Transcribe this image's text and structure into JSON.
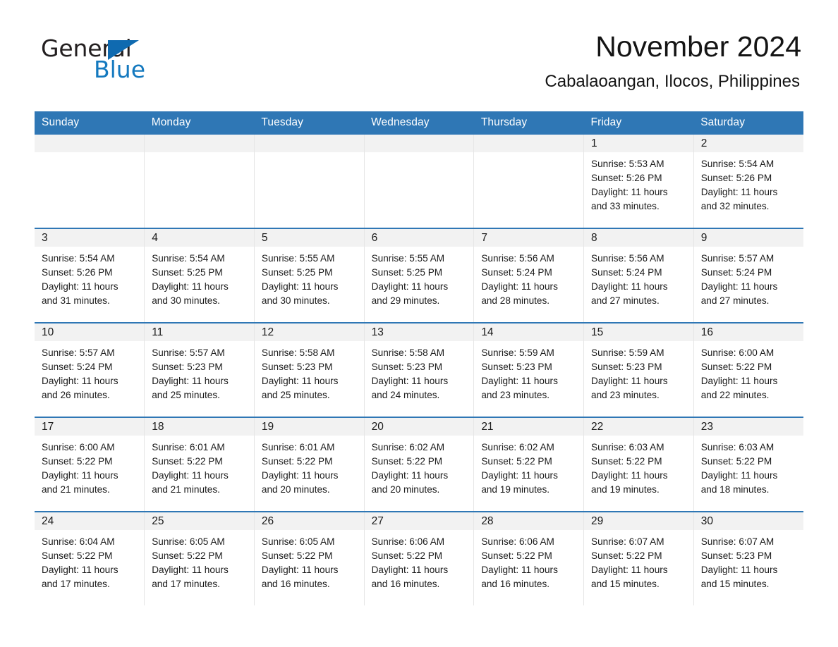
{
  "brand": {
    "name_part1": "General",
    "name_part2": "Blue",
    "triangle_color": "#0f6ab0",
    "blue_text_color": "#1479bf"
  },
  "header": {
    "title": "November 2024",
    "subtitle": "Cabalaoangan, Ilocos, Philippines",
    "header_bg_color": "#2f77b5",
    "daynum_band_color": "#f2f2f2"
  },
  "weekdays": [
    "Sunday",
    "Monday",
    "Tuesday",
    "Wednesday",
    "Thursday",
    "Friday",
    "Saturday"
  ],
  "weeks": [
    [
      {
        "day": "",
        "info": ""
      },
      {
        "day": "",
        "info": ""
      },
      {
        "day": "",
        "info": ""
      },
      {
        "day": "",
        "info": ""
      },
      {
        "day": "",
        "info": ""
      },
      {
        "day": "1",
        "info": "Sunrise: 5:53 AM\nSunset: 5:26 PM\nDaylight: 11 hours\nand 33 minutes."
      },
      {
        "day": "2",
        "info": "Sunrise: 5:54 AM\nSunset: 5:26 PM\nDaylight: 11 hours\nand 32 minutes."
      }
    ],
    [
      {
        "day": "3",
        "info": "Sunrise: 5:54 AM\nSunset: 5:26 PM\nDaylight: 11 hours\nand 31 minutes."
      },
      {
        "day": "4",
        "info": "Sunrise: 5:54 AM\nSunset: 5:25 PM\nDaylight: 11 hours\nand 30 minutes."
      },
      {
        "day": "5",
        "info": "Sunrise: 5:55 AM\nSunset: 5:25 PM\nDaylight: 11 hours\nand 30 minutes."
      },
      {
        "day": "6",
        "info": "Sunrise: 5:55 AM\nSunset: 5:25 PM\nDaylight: 11 hours\nand 29 minutes."
      },
      {
        "day": "7",
        "info": "Sunrise: 5:56 AM\nSunset: 5:24 PM\nDaylight: 11 hours\nand 28 minutes."
      },
      {
        "day": "8",
        "info": "Sunrise: 5:56 AM\nSunset: 5:24 PM\nDaylight: 11 hours\nand 27 minutes."
      },
      {
        "day": "9",
        "info": "Sunrise: 5:57 AM\nSunset: 5:24 PM\nDaylight: 11 hours\nand 27 minutes."
      }
    ],
    [
      {
        "day": "10",
        "info": "Sunrise: 5:57 AM\nSunset: 5:24 PM\nDaylight: 11 hours\nand 26 minutes."
      },
      {
        "day": "11",
        "info": "Sunrise: 5:57 AM\nSunset: 5:23 PM\nDaylight: 11 hours\nand 25 minutes."
      },
      {
        "day": "12",
        "info": "Sunrise: 5:58 AM\nSunset: 5:23 PM\nDaylight: 11 hours\nand 25 minutes."
      },
      {
        "day": "13",
        "info": "Sunrise: 5:58 AM\nSunset: 5:23 PM\nDaylight: 11 hours\nand 24 minutes."
      },
      {
        "day": "14",
        "info": "Sunrise: 5:59 AM\nSunset: 5:23 PM\nDaylight: 11 hours\nand 23 minutes."
      },
      {
        "day": "15",
        "info": "Sunrise: 5:59 AM\nSunset: 5:23 PM\nDaylight: 11 hours\nand 23 minutes."
      },
      {
        "day": "16",
        "info": "Sunrise: 6:00 AM\nSunset: 5:22 PM\nDaylight: 11 hours\nand 22 minutes."
      }
    ],
    [
      {
        "day": "17",
        "info": "Sunrise: 6:00 AM\nSunset: 5:22 PM\nDaylight: 11 hours\nand 21 minutes."
      },
      {
        "day": "18",
        "info": "Sunrise: 6:01 AM\nSunset: 5:22 PM\nDaylight: 11 hours\nand 21 minutes."
      },
      {
        "day": "19",
        "info": "Sunrise: 6:01 AM\nSunset: 5:22 PM\nDaylight: 11 hours\nand 20 minutes."
      },
      {
        "day": "20",
        "info": "Sunrise: 6:02 AM\nSunset: 5:22 PM\nDaylight: 11 hours\nand 20 minutes."
      },
      {
        "day": "21",
        "info": "Sunrise: 6:02 AM\nSunset: 5:22 PM\nDaylight: 11 hours\nand 19 minutes."
      },
      {
        "day": "22",
        "info": "Sunrise: 6:03 AM\nSunset: 5:22 PM\nDaylight: 11 hours\nand 19 minutes."
      },
      {
        "day": "23",
        "info": "Sunrise: 6:03 AM\nSunset: 5:22 PM\nDaylight: 11 hours\nand 18 minutes."
      }
    ],
    [
      {
        "day": "24",
        "info": "Sunrise: 6:04 AM\nSunset: 5:22 PM\nDaylight: 11 hours\nand 17 minutes."
      },
      {
        "day": "25",
        "info": "Sunrise: 6:05 AM\nSunset: 5:22 PM\nDaylight: 11 hours\nand 17 minutes."
      },
      {
        "day": "26",
        "info": "Sunrise: 6:05 AM\nSunset: 5:22 PM\nDaylight: 11 hours\nand 16 minutes."
      },
      {
        "day": "27",
        "info": "Sunrise: 6:06 AM\nSunset: 5:22 PM\nDaylight: 11 hours\nand 16 minutes."
      },
      {
        "day": "28",
        "info": "Sunrise: 6:06 AM\nSunset: 5:22 PM\nDaylight: 11 hours\nand 16 minutes."
      },
      {
        "day": "29",
        "info": "Sunrise: 6:07 AM\nSunset: 5:22 PM\nDaylight: 11 hours\nand 15 minutes."
      },
      {
        "day": "30",
        "info": "Sunrise: 6:07 AM\nSunset: 5:23 PM\nDaylight: 11 hours\nand 15 minutes."
      }
    ]
  ]
}
